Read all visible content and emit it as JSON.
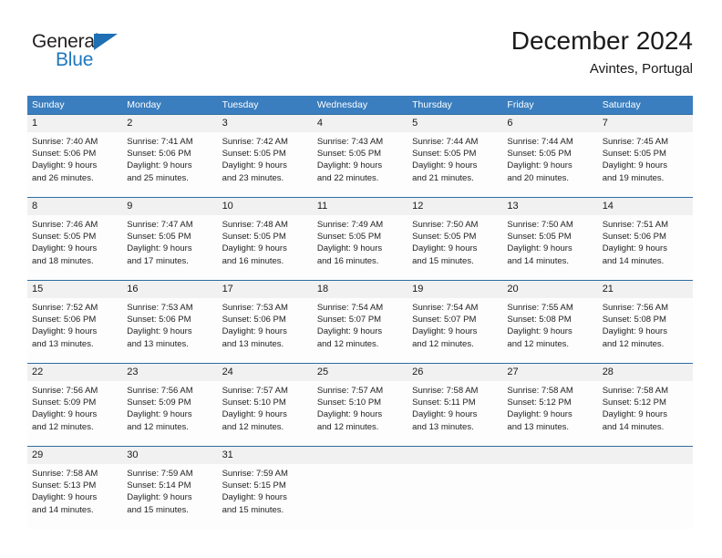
{
  "brand": {
    "name_part1": "General",
    "name_part2": "Blue",
    "flag_icon": "triangle-flag-icon",
    "colors": {
      "blue": "#1f6fb4",
      "dark": "#231f20"
    }
  },
  "header": {
    "title": "December 2024",
    "location": "Avintes, Portugal"
  },
  "calendar": {
    "header_bg": "#3a7ebf",
    "daynum_bg": "#f1f1f1",
    "separator_color": "#2e6da4",
    "weekdays": [
      "Sunday",
      "Monday",
      "Tuesday",
      "Wednesday",
      "Thursday",
      "Friday",
      "Saturday"
    ],
    "weeks": [
      {
        "days": [
          {
            "num": "1",
            "sunrise": "Sunrise: 7:40 AM",
            "sunset": "Sunset: 5:06 PM",
            "daylight_line1": "Daylight: 9 hours",
            "daylight_line2": "and 26 minutes."
          },
          {
            "num": "2",
            "sunrise": "Sunrise: 7:41 AM",
            "sunset": "Sunset: 5:06 PM",
            "daylight_line1": "Daylight: 9 hours",
            "daylight_line2": "and 25 minutes."
          },
          {
            "num": "3",
            "sunrise": "Sunrise: 7:42 AM",
            "sunset": "Sunset: 5:05 PM",
            "daylight_line1": "Daylight: 9 hours",
            "daylight_line2": "and 23 minutes."
          },
          {
            "num": "4",
            "sunrise": "Sunrise: 7:43 AM",
            "sunset": "Sunset: 5:05 PM",
            "daylight_line1": "Daylight: 9 hours",
            "daylight_line2": "and 22 minutes."
          },
          {
            "num": "5",
            "sunrise": "Sunrise: 7:44 AM",
            "sunset": "Sunset: 5:05 PM",
            "daylight_line1": "Daylight: 9 hours",
            "daylight_line2": "and 21 minutes."
          },
          {
            "num": "6",
            "sunrise": "Sunrise: 7:44 AM",
            "sunset": "Sunset: 5:05 PM",
            "daylight_line1": "Daylight: 9 hours",
            "daylight_line2": "and 20 minutes."
          },
          {
            "num": "7",
            "sunrise": "Sunrise: 7:45 AM",
            "sunset": "Sunset: 5:05 PM",
            "daylight_line1": "Daylight: 9 hours",
            "daylight_line2": "and 19 minutes."
          }
        ]
      },
      {
        "days": [
          {
            "num": "8",
            "sunrise": "Sunrise: 7:46 AM",
            "sunset": "Sunset: 5:05 PM",
            "daylight_line1": "Daylight: 9 hours",
            "daylight_line2": "and 18 minutes."
          },
          {
            "num": "9",
            "sunrise": "Sunrise: 7:47 AM",
            "sunset": "Sunset: 5:05 PM",
            "daylight_line1": "Daylight: 9 hours",
            "daylight_line2": "and 17 minutes."
          },
          {
            "num": "10",
            "sunrise": "Sunrise: 7:48 AM",
            "sunset": "Sunset: 5:05 PM",
            "daylight_line1": "Daylight: 9 hours",
            "daylight_line2": "and 16 minutes."
          },
          {
            "num": "11",
            "sunrise": "Sunrise: 7:49 AM",
            "sunset": "Sunset: 5:05 PM",
            "daylight_line1": "Daylight: 9 hours",
            "daylight_line2": "and 16 minutes."
          },
          {
            "num": "12",
            "sunrise": "Sunrise: 7:50 AM",
            "sunset": "Sunset: 5:05 PM",
            "daylight_line1": "Daylight: 9 hours",
            "daylight_line2": "and 15 minutes."
          },
          {
            "num": "13",
            "sunrise": "Sunrise: 7:50 AM",
            "sunset": "Sunset: 5:05 PM",
            "daylight_line1": "Daylight: 9 hours",
            "daylight_line2": "and 14 minutes."
          },
          {
            "num": "14",
            "sunrise": "Sunrise: 7:51 AM",
            "sunset": "Sunset: 5:06 PM",
            "daylight_line1": "Daylight: 9 hours",
            "daylight_line2": "and 14 minutes."
          }
        ]
      },
      {
        "days": [
          {
            "num": "15",
            "sunrise": "Sunrise: 7:52 AM",
            "sunset": "Sunset: 5:06 PM",
            "daylight_line1": "Daylight: 9 hours",
            "daylight_line2": "and 13 minutes."
          },
          {
            "num": "16",
            "sunrise": "Sunrise: 7:53 AM",
            "sunset": "Sunset: 5:06 PM",
            "daylight_line1": "Daylight: 9 hours",
            "daylight_line2": "and 13 minutes."
          },
          {
            "num": "17",
            "sunrise": "Sunrise: 7:53 AM",
            "sunset": "Sunset: 5:06 PM",
            "daylight_line1": "Daylight: 9 hours",
            "daylight_line2": "and 13 minutes."
          },
          {
            "num": "18",
            "sunrise": "Sunrise: 7:54 AM",
            "sunset": "Sunset: 5:07 PM",
            "daylight_line1": "Daylight: 9 hours",
            "daylight_line2": "and 12 minutes."
          },
          {
            "num": "19",
            "sunrise": "Sunrise: 7:54 AM",
            "sunset": "Sunset: 5:07 PM",
            "daylight_line1": "Daylight: 9 hours",
            "daylight_line2": "and 12 minutes."
          },
          {
            "num": "20",
            "sunrise": "Sunrise: 7:55 AM",
            "sunset": "Sunset: 5:08 PM",
            "daylight_line1": "Daylight: 9 hours",
            "daylight_line2": "and 12 minutes."
          },
          {
            "num": "21",
            "sunrise": "Sunrise: 7:56 AM",
            "sunset": "Sunset: 5:08 PM",
            "daylight_line1": "Daylight: 9 hours",
            "daylight_line2": "and 12 minutes."
          }
        ]
      },
      {
        "days": [
          {
            "num": "22",
            "sunrise": "Sunrise: 7:56 AM",
            "sunset": "Sunset: 5:09 PM",
            "daylight_line1": "Daylight: 9 hours",
            "daylight_line2": "and 12 minutes."
          },
          {
            "num": "23",
            "sunrise": "Sunrise: 7:56 AM",
            "sunset": "Sunset: 5:09 PM",
            "daylight_line1": "Daylight: 9 hours",
            "daylight_line2": "and 12 minutes."
          },
          {
            "num": "24",
            "sunrise": "Sunrise: 7:57 AM",
            "sunset": "Sunset: 5:10 PM",
            "daylight_line1": "Daylight: 9 hours",
            "daylight_line2": "and 12 minutes."
          },
          {
            "num": "25",
            "sunrise": "Sunrise: 7:57 AM",
            "sunset": "Sunset: 5:10 PM",
            "daylight_line1": "Daylight: 9 hours",
            "daylight_line2": "and 12 minutes."
          },
          {
            "num": "26",
            "sunrise": "Sunrise: 7:58 AM",
            "sunset": "Sunset: 5:11 PM",
            "daylight_line1": "Daylight: 9 hours",
            "daylight_line2": "and 13 minutes."
          },
          {
            "num": "27",
            "sunrise": "Sunrise: 7:58 AM",
            "sunset": "Sunset: 5:12 PM",
            "daylight_line1": "Daylight: 9 hours",
            "daylight_line2": "and 13 minutes."
          },
          {
            "num": "28",
            "sunrise": "Sunrise: 7:58 AM",
            "sunset": "Sunset: 5:12 PM",
            "daylight_line1": "Daylight: 9 hours",
            "daylight_line2": "and 14 minutes."
          }
        ]
      },
      {
        "days": [
          {
            "num": "29",
            "sunrise": "Sunrise: 7:58 AM",
            "sunset": "Sunset: 5:13 PM",
            "daylight_line1": "Daylight: 9 hours",
            "daylight_line2": "and 14 minutes."
          },
          {
            "num": "30",
            "sunrise": "Sunrise: 7:59 AM",
            "sunset": "Sunset: 5:14 PM",
            "daylight_line1": "Daylight: 9 hours",
            "daylight_line2": "and 15 minutes."
          },
          {
            "num": "31",
            "sunrise": "Sunrise: 7:59 AM",
            "sunset": "Sunset: 5:15 PM",
            "daylight_line1": "Daylight: 9 hours",
            "daylight_line2": "and 15 minutes."
          },
          {
            "num": "",
            "sunrise": "",
            "sunset": "",
            "daylight_line1": "",
            "daylight_line2": ""
          },
          {
            "num": "",
            "sunrise": "",
            "sunset": "",
            "daylight_line1": "",
            "daylight_line2": ""
          },
          {
            "num": "",
            "sunrise": "",
            "sunset": "",
            "daylight_line1": "",
            "daylight_line2": ""
          },
          {
            "num": "",
            "sunrise": "",
            "sunset": "",
            "daylight_line1": "",
            "daylight_line2": ""
          }
        ]
      }
    ]
  }
}
